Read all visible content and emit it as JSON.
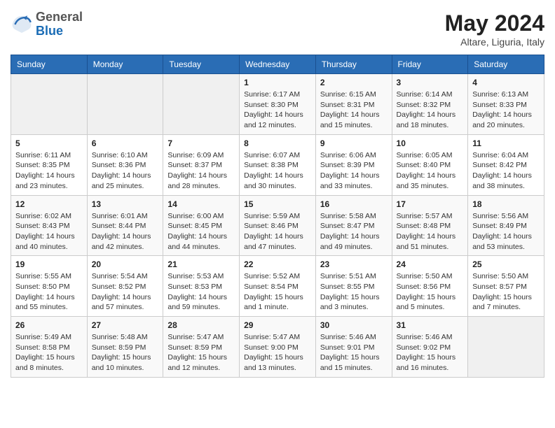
{
  "header": {
    "logo": {
      "general": "General",
      "blue": "Blue"
    },
    "month": "May 2024",
    "location": "Altare, Liguria, Italy"
  },
  "weekdays": [
    "Sunday",
    "Monday",
    "Tuesday",
    "Wednesday",
    "Thursday",
    "Friday",
    "Saturday"
  ],
  "weeks": [
    [
      {
        "day": "",
        "info": ""
      },
      {
        "day": "",
        "info": ""
      },
      {
        "day": "",
        "info": ""
      },
      {
        "day": "1",
        "info": "Sunrise: 6:17 AM\nSunset: 8:30 PM\nDaylight: 14 hours\nand 12 minutes."
      },
      {
        "day": "2",
        "info": "Sunrise: 6:15 AM\nSunset: 8:31 PM\nDaylight: 14 hours\nand 15 minutes."
      },
      {
        "day": "3",
        "info": "Sunrise: 6:14 AM\nSunset: 8:32 PM\nDaylight: 14 hours\nand 18 minutes."
      },
      {
        "day": "4",
        "info": "Sunrise: 6:13 AM\nSunset: 8:33 PM\nDaylight: 14 hours\nand 20 minutes."
      }
    ],
    [
      {
        "day": "5",
        "info": "Sunrise: 6:11 AM\nSunset: 8:35 PM\nDaylight: 14 hours\nand 23 minutes."
      },
      {
        "day": "6",
        "info": "Sunrise: 6:10 AM\nSunset: 8:36 PM\nDaylight: 14 hours\nand 25 minutes."
      },
      {
        "day": "7",
        "info": "Sunrise: 6:09 AM\nSunset: 8:37 PM\nDaylight: 14 hours\nand 28 minutes."
      },
      {
        "day": "8",
        "info": "Sunrise: 6:07 AM\nSunset: 8:38 PM\nDaylight: 14 hours\nand 30 minutes."
      },
      {
        "day": "9",
        "info": "Sunrise: 6:06 AM\nSunset: 8:39 PM\nDaylight: 14 hours\nand 33 minutes."
      },
      {
        "day": "10",
        "info": "Sunrise: 6:05 AM\nSunset: 8:40 PM\nDaylight: 14 hours\nand 35 minutes."
      },
      {
        "day": "11",
        "info": "Sunrise: 6:04 AM\nSunset: 8:42 PM\nDaylight: 14 hours\nand 38 minutes."
      }
    ],
    [
      {
        "day": "12",
        "info": "Sunrise: 6:02 AM\nSunset: 8:43 PM\nDaylight: 14 hours\nand 40 minutes."
      },
      {
        "day": "13",
        "info": "Sunrise: 6:01 AM\nSunset: 8:44 PM\nDaylight: 14 hours\nand 42 minutes."
      },
      {
        "day": "14",
        "info": "Sunrise: 6:00 AM\nSunset: 8:45 PM\nDaylight: 14 hours\nand 44 minutes."
      },
      {
        "day": "15",
        "info": "Sunrise: 5:59 AM\nSunset: 8:46 PM\nDaylight: 14 hours\nand 47 minutes."
      },
      {
        "day": "16",
        "info": "Sunrise: 5:58 AM\nSunset: 8:47 PM\nDaylight: 14 hours\nand 49 minutes."
      },
      {
        "day": "17",
        "info": "Sunrise: 5:57 AM\nSunset: 8:48 PM\nDaylight: 14 hours\nand 51 minutes."
      },
      {
        "day": "18",
        "info": "Sunrise: 5:56 AM\nSunset: 8:49 PM\nDaylight: 14 hours\nand 53 minutes."
      }
    ],
    [
      {
        "day": "19",
        "info": "Sunrise: 5:55 AM\nSunset: 8:50 PM\nDaylight: 14 hours\nand 55 minutes."
      },
      {
        "day": "20",
        "info": "Sunrise: 5:54 AM\nSunset: 8:52 PM\nDaylight: 14 hours\nand 57 minutes."
      },
      {
        "day": "21",
        "info": "Sunrise: 5:53 AM\nSunset: 8:53 PM\nDaylight: 14 hours\nand 59 minutes."
      },
      {
        "day": "22",
        "info": "Sunrise: 5:52 AM\nSunset: 8:54 PM\nDaylight: 15 hours\nand 1 minute."
      },
      {
        "day": "23",
        "info": "Sunrise: 5:51 AM\nSunset: 8:55 PM\nDaylight: 15 hours\nand 3 minutes."
      },
      {
        "day": "24",
        "info": "Sunrise: 5:50 AM\nSunset: 8:56 PM\nDaylight: 15 hours\nand 5 minutes."
      },
      {
        "day": "25",
        "info": "Sunrise: 5:50 AM\nSunset: 8:57 PM\nDaylight: 15 hours\nand 7 minutes."
      }
    ],
    [
      {
        "day": "26",
        "info": "Sunrise: 5:49 AM\nSunset: 8:58 PM\nDaylight: 15 hours\nand 8 minutes."
      },
      {
        "day": "27",
        "info": "Sunrise: 5:48 AM\nSunset: 8:59 PM\nDaylight: 15 hours\nand 10 minutes."
      },
      {
        "day": "28",
        "info": "Sunrise: 5:47 AM\nSunset: 8:59 PM\nDaylight: 15 hours\nand 12 minutes."
      },
      {
        "day": "29",
        "info": "Sunrise: 5:47 AM\nSunset: 9:00 PM\nDaylight: 15 hours\nand 13 minutes."
      },
      {
        "day": "30",
        "info": "Sunrise: 5:46 AM\nSunset: 9:01 PM\nDaylight: 15 hours\nand 15 minutes."
      },
      {
        "day": "31",
        "info": "Sunrise: 5:46 AM\nSunset: 9:02 PM\nDaylight: 15 hours\nand 16 minutes."
      },
      {
        "day": "",
        "info": ""
      }
    ]
  ]
}
